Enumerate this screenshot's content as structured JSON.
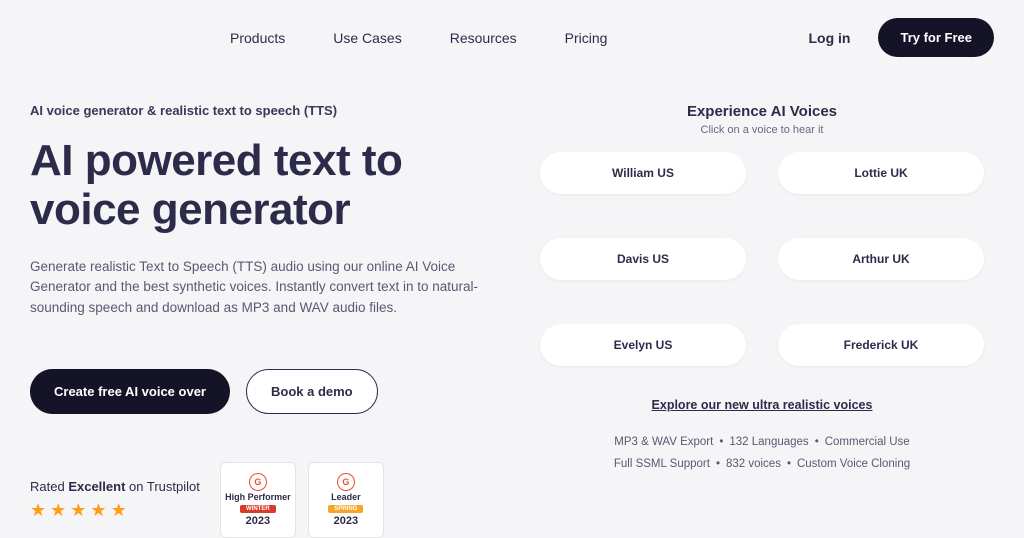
{
  "nav": {
    "links": [
      "Products",
      "Use Cases",
      "Resources",
      "Pricing"
    ],
    "login": "Log in",
    "tryFree": "Try for Free"
  },
  "hero": {
    "tagline": "AI voice generator & realistic text to speech (TTS)",
    "title": "AI powered text to voice generator",
    "description": "Generate realistic Text to Speech (TTS) audio using our online AI Voice Generator and the best synthetic voices. Instantly convert text in to natural-sounding speech and download as MP3 and WAV audio files.",
    "ctaPrimary": "Create free AI voice over",
    "ctaSecondary": "Book a demo"
  },
  "trust": {
    "ratedPrefix": "Rated ",
    "ratedStrong": "Excellent",
    "ratedSuffix": " on Trustpilot",
    "badges": [
      {
        "label": "High Performer",
        "season": "WINTER",
        "year": "2023"
      },
      {
        "label": "Leader",
        "season": "SPRING",
        "year": "2023"
      }
    ]
  },
  "voices": {
    "title": "Experience AI Voices",
    "subtitle": "Click on a voice to hear it",
    "items": [
      "William US",
      "Lottie UK",
      "Davis US",
      "Arthur UK",
      "Evelyn US",
      "Frederick UK"
    ],
    "exploreLink": "Explore our new ultra realistic voices",
    "featuresLine1": [
      "MP3 & WAV Export",
      "132 Languages",
      "Commercial Use"
    ],
    "featuresLine2": [
      "Full SSML Support",
      "832 voices",
      "Custom Voice Cloning"
    ]
  }
}
